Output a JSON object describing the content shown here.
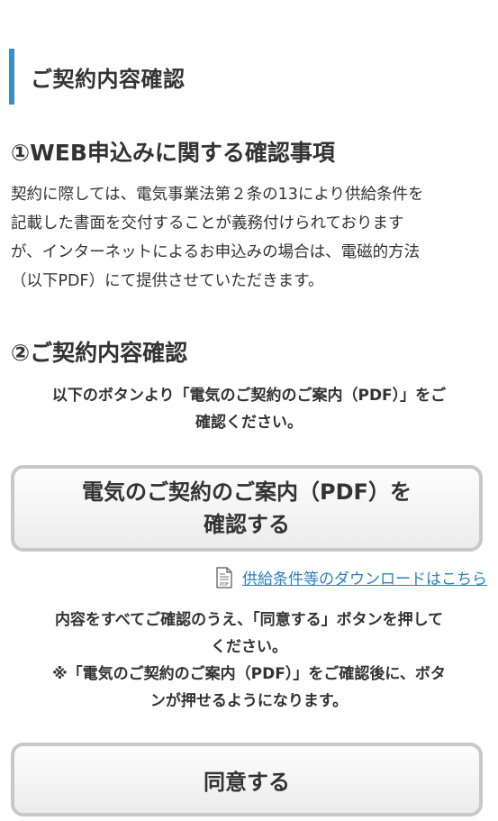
{
  "page": {
    "title": "ご契約内容確認"
  },
  "section1": {
    "title": "①WEB申込みに関する確認事項",
    "body_lines": [
      "契約に際しては、電気事業法第２条の13により供給条件を",
      "記載した書面を交付することが義務付けられております",
      "が、インターネットによるお申込みの場合は、電磁的方法",
      "（以下PDF）にて提供させていただきます。"
    ]
  },
  "section2": {
    "title": "②ご契約内容確認",
    "instruction_lines": [
      "以下のボタンより「電気のご契約のご案内（PDF）」をご",
      "確認ください。"
    ],
    "pdf_button_lines": [
      "電気のご契約のご案内（PDF）を",
      "確認する"
    ],
    "download_link": {
      "icon": "pdf-document-icon",
      "icon_label": "PDF",
      "label": "供給条件等のダウンロードはこちら"
    },
    "agree_instruction_lines": [
      "内容をすべてご確認のうえ、「同意する」ボタンを押して",
      "ください。",
      "※「電気のご契約のご案内（PDF）」をご確認後に、ボタ",
      "ンが押せるようになります。"
    ],
    "agree_button_label": "同意する"
  },
  "colors": {
    "accent": "#3b8fc9",
    "link": "#2f7fbf",
    "text": "#333333",
    "button_border": "#c8c8c8"
  }
}
